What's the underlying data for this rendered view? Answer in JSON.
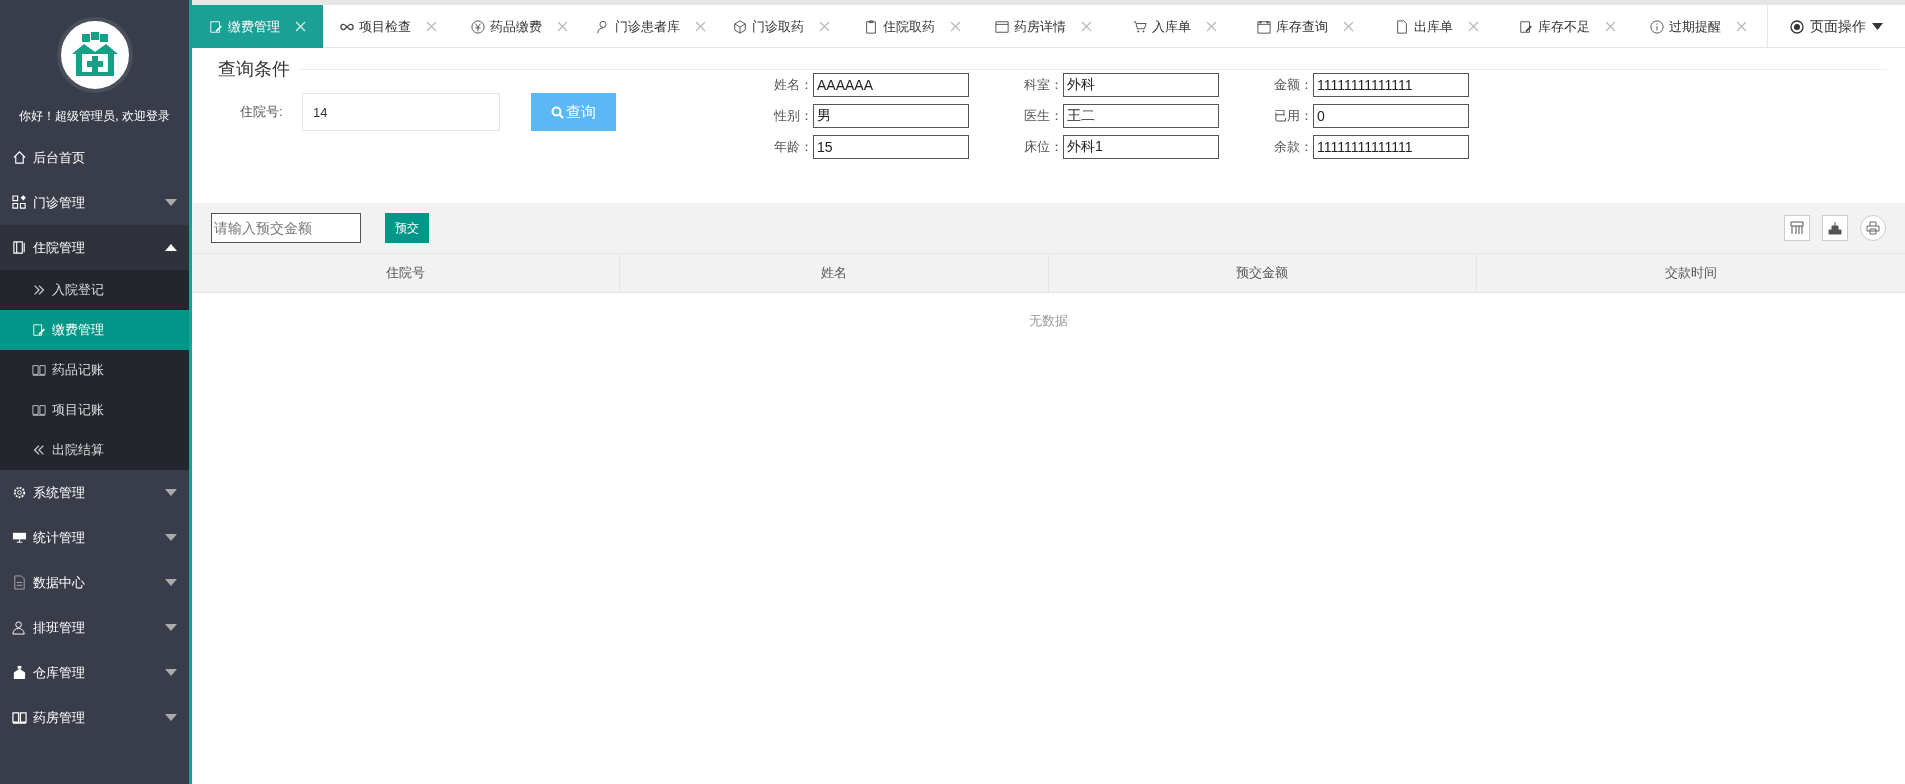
{
  "sidebar": {
    "greeting": "你好！超级管理员, 欢迎登录",
    "items": [
      {
        "label": "后台首页"
      },
      {
        "label": "门诊管理",
        "expanded": false
      },
      {
        "label": "住院管理",
        "expanded": true,
        "children": [
          {
            "label": "入院登记",
            "selected": false
          },
          {
            "label": "缴费管理",
            "selected": true
          },
          {
            "label": "药品记账",
            "selected": false
          },
          {
            "label": "项目记账",
            "selected": false
          },
          {
            "label": "出院结算",
            "selected": false
          }
        ]
      },
      {
        "label": "系统管理",
        "expanded": false
      },
      {
        "label": "统计管理",
        "expanded": false
      },
      {
        "label": "数据中心",
        "expanded": false
      },
      {
        "label": "排班管理",
        "expanded": false
      },
      {
        "label": "仓库管理",
        "expanded": false
      },
      {
        "label": "药房管理",
        "expanded": false
      }
    ]
  },
  "tabs": [
    {
      "label": "缴费管理",
      "selected": true
    },
    {
      "label": "项目检查",
      "selected": false
    },
    {
      "label": "药品缴费",
      "selected": false
    },
    {
      "label": "门诊患者库",
      "selected": false
    },
    {
      "label": "门诊取药",
      "selected": false
    },
    {
      "label": "住院取药",
      "selected": false
    },
    {
      "label": "药房详情",
      "selected": false
    },
    {
      "label": "入库单",
      "selected": false
    },
    {
      "label": "库存查询",
      "selected": false
    },
    {
      "label": "出库单",
      "selected": false
    },
    {
      "label": "库存不足",
      "selected": false
    },
    {
      "label": "过期提醒",
      "selected": false
    }
  ],
  "page_actions": "页面操作",
  "query": {
    "title": "查询条件",
    "label": "住院号:",
    "value": "14",
    "button": "查询",
    "fields": [
      {
        "label": "姓名：",
        "value": "AAAAAA"
      },
      {
        "label": "科室：",
        "value": "外科"
      },
      {
        "label": "金额：",
        "value": "11111111111111"
      },
      {
        "label": "性别：",
        "value": "男"
      },
      {
        "label": "医生：",
        "value": "王二"
      },
      {
        "label": "已用：",
        "value": "0"
      },
      {
        "label": "年龄：",
        "value": "15"
      },
      {
        "label": "床位：",
        "value": "外科1"
      },
      {
        "label": "余款：",
        "value": "11111111111111"
      }
    ]
  },
  "toolbar": {
    "placeholder": "请输入预交金额",
    "button": "预交"
  },
  "table": {
    "columns": [
      "住院号",
      "姓名",
      "预交金额",
      "交款时间"
    ],
    "empty": "无数据"
  }
}
